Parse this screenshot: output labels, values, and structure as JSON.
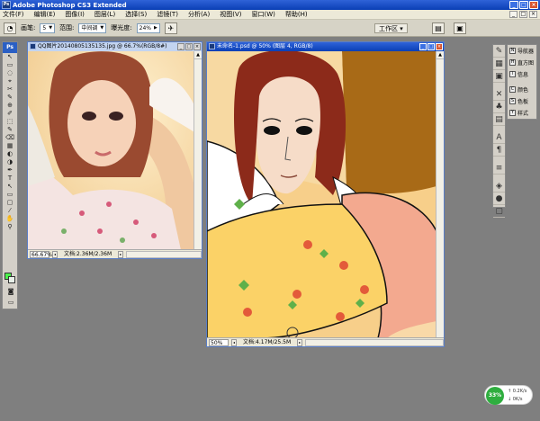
{
  "app": {
    "title": "Adobe Photoshop CS3 Extended",
    "logo_text": "Ps"
  },
  "menu": [
    "文件(F)",
    "编辑(E)",
    "图像(I)",
    "图层(L)",
    "选择(S)",
    "滤镜(T)",
    "分析(A)",
    "视图(V)",
    "窗口(W)",
    "帮助(H)"
  ],
  "options": {
    "brush_label": "画笔:",
    "brush_size": "5",
    "range_label": "范围:",
    "range_value": "中间调",
    "exposure_label": "曝光度:",
    "exposure_value": "24%",
    "workspace_label": "工作区 ▾"
  },
  "tools": [
    "▭",
    "⬚",
    "◌",
    "✂",
    "⌖",
    "✎",
    "⊕",
    "✐",
    "⌫",
    "▦",
    "◐",
    "◑",
    "✒",
    "T",
    "↖",
    "▭",
    "✎",
    "✋",
    "⚲"
  ],
  "doc1": {
    "title": "QQ图片20140805135135.jpg @ 66.7%(RGB/8#)",
    "zoom": "66.67%",
    "doc_info": "文档:2.36M/2.36M"
  },
  "doc2": {
    "title": "未命名-1.psd @ 50% (图层 4, RGB/8)",
    "zoom": "50%",
    "doc_info": "文档:4.17M/25.5M"
  },
  "panels": [
    {
      "icon": "N",
      "label": "导航器"
    },
    {
      "icon": "H",
      "label": "直方图"
    },
    {
      "icon": "i",
      "label": "信息"
    },
    {
      "icon": "C",
      "label": "颜色"
    },
    {
      "icon": "S",
      "label": "色板"
    },
    {
      "icon": "Y",
      "label": "样式"
    }
  ],
  "network": {
    "percent": "33%",
    "up": "0.2K/s",
    "down": "0K/s"
  },
  "colors": {
    "foreground": "#4df04d",
    "background": "#e8f0e8",
    "accent": "#0a3fb5"
  }
}
